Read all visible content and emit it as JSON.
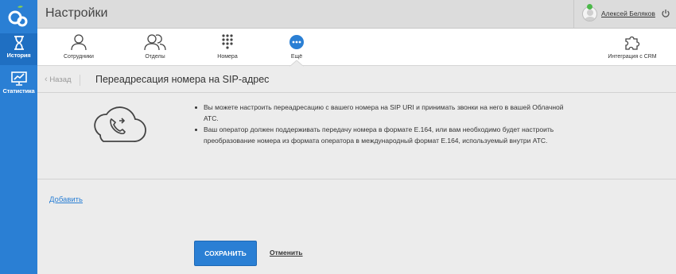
{
  "header": {
    "title": "Настройки"
  },
  "user": {
    "name": "Алексей Беляков"
  },
  "rail": {
    "items": [
      {
        "label": "История",
        "icon": "hourglass-icon"
      },
      {
        "label": "Статистика",
        "icon": "chart-monitor-icon"
      }
    ]
  },
  "tabs": [
    {
      "label": "Сотрудники",
      "icon": "user-icon"
    },
    {
      "label": "Отделы",
      "icon": "users-icon"
    },
    {
      "label": "Номера",
      "icon": "keypad-icon"
    },
    {
      "label": "Ещё",
      "icon": "more-icon",
      "active": true
    },
    {
      "label": "Интеграция с CRM",
      "icon": "puzzle-icon"
    }
  ],
  "breadcrumb": {
    "back_label": "Назад",
    "title": "Переадресация номера на SIP-адрес"
  },
  "info": {
    "bullets": [
      "Вы можете настроить переадресацию с вашего номера на SIP URI и принимать звонки на него в вашей Облачной АТС.",
      "Ваш оператор должен поддерживать передачу номера в формате E.164, или вам необходимо будет настроить преобразование номера из формата оператора в международный формат E.164, используемый внутри АТС."
    ]
  },
  "actions": {
    "add_label": "Добавить",
    "save_label": "СОХРАНИТЬ",
    "cancel_label": "Отменить"
  },
  "colors": {
    "accent": "#2a7fd4",
    "rail": "#2a7fd4",
    "status_online": "#4cb84a"
  }
}
